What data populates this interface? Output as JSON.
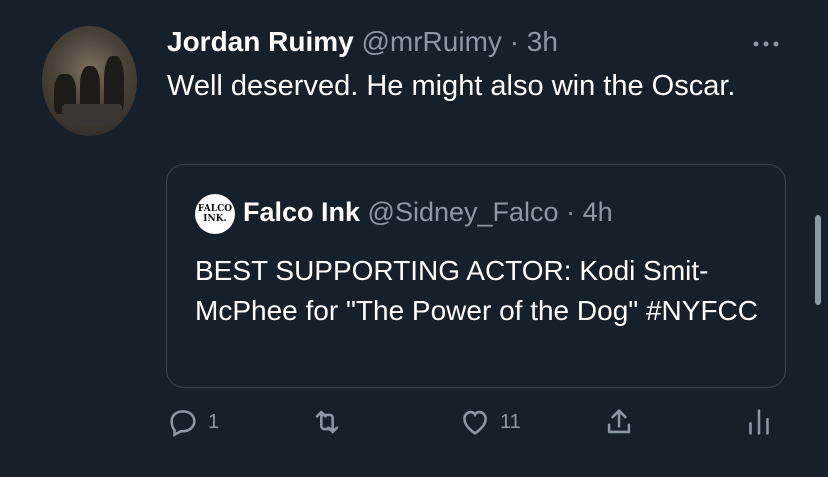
{
  "tweet": {
    "name": "Jordan Ruimy",
    "handle": "@mrRuimy",
    "separator": "·",
    "time": "3h",
    "text": "Well deserved. He might also win the Oscar.",
    "more_icon": "more-icon"
  },
  "quoted": {
    "name": "Falco Ink",
    "handle": "@Sidney_Falco",
    "separator": "·",
    "time": "4h",
    "text": "BEST SUPPORTING ACTOR: Kodi Smit-McPhee for \"The Power of the Dog\" #NYFCC",
    "avatar_text": "FALCO INK."
  },
  "actions": {
    "reply_count": "1",
    "retweet_count": "",
    "like_count": "11",
    "share_count": "",
    "analytics_icon": "analytics-icon"
  },
  "colors": {
    "background": "#15202b",
    "secondary_text": "#8b98a5",
    "border": "#38444d"
  }
}
